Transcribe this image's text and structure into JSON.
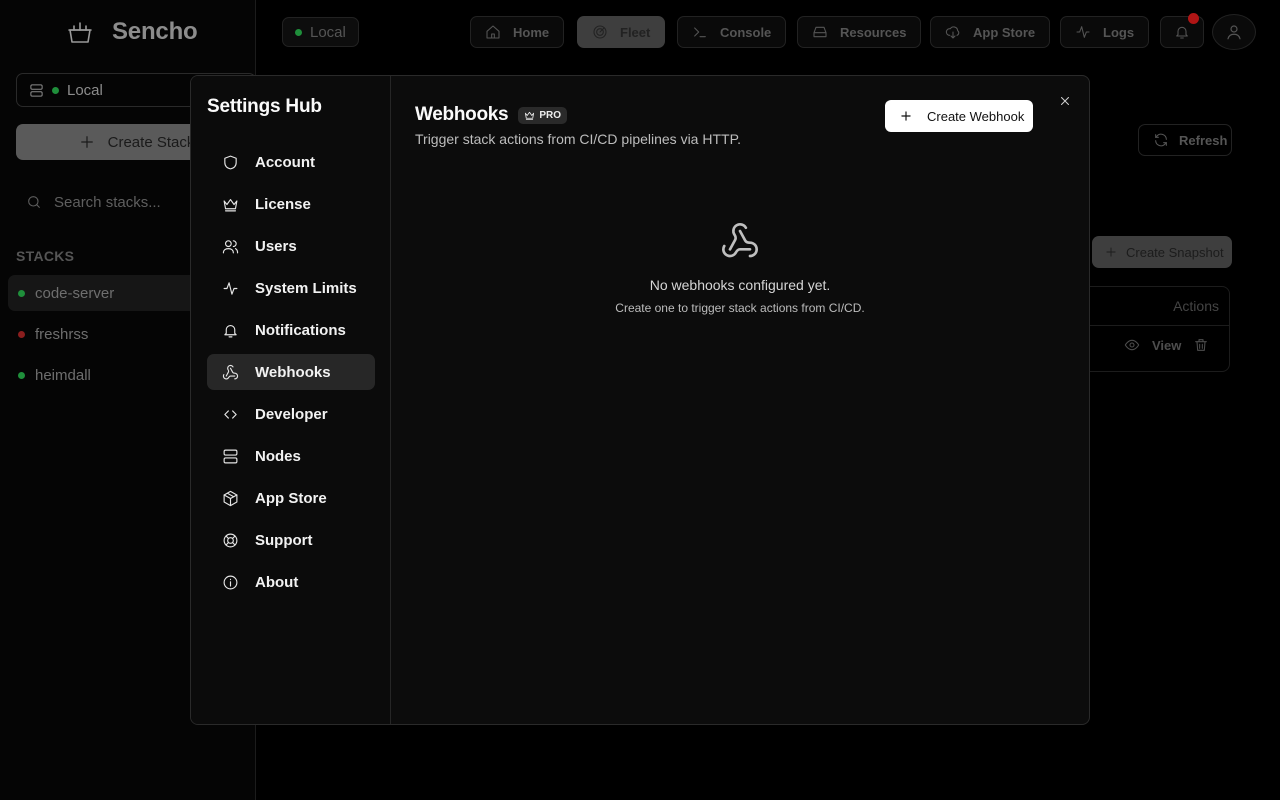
{
  "app": {
    "name": "Sencho",
    "node": "Local",
    "create_stack": "Create Stack",
    "search_placeholder": "Search stacks...",
    "stacks_label": "STACKS",
    "stacks": [
      {
        "name": "code-server",
        "status": "running"
      },
      {
        "name": "freshrss",
        "status": "stopped"
      },
      {
        "name": "heimdall",
        "status": "running"
      }
    ],
    "nav": [
      {
        "label": "Home",
        "icon": "home-icon"
      },
      {
        "label": "Fleet",
        "icon": "radar-icon",
        "active": true
      },
      {
        "label": "Console",
        "icon": "terminal-icon"
      },
      {
        "label": "Resources",
        "icon": "hard-drive-icon"
      },
      {
        "label": "App Store",
        "icon": "cloud-download-icon"
      },
      {
        "label": "Logs",
        "icon": "activity-icon"
      }
    ],
    "refresh": "Refresh",
    "create_snapshot": "Create Snapshot",
    "table_actions_header": "Actions",
    "view": "View"
  },
  "settings": {
    "title": "Settings Hub",
    "menu": [
      {
        "label": "Account",
        "icon": "shield-icon"
      },
      {
        "label": "License",
        "icon": "crown-icon"
      },
      {
        "label": "Users",
        "icon": "users-icon"
      },
      {
        "label": "System Limits",
        "icon": "activity-icon"
      },
      {
        "label": "Notifications",
        "icon": "bell-icon"
      },
      {
        "label": "Webhooks",
        "icon": "webhook-icon",
        "active": true
      },
      {
        "label": "Developer",
        "icon": "code-icon"
      },
      {
        "label": "Nodes",
        "icon": "server-icon"
      },
      {
        "label": "App Store",
        "icon": "package-icon"
      },
      {
        "label": "Support",
        "icon": "life-buoy-icon"
      },
      {
        "label": "About",
        "icon": "info-icon"
      }
    ],
    "page": {
      "title": "Webhooks",
      "badge": "PRO",
      "subtitle": "Trigger stack actions from CI/CD pipelines via HTTP.",
      "create_button": "Create Webhook",
      "empty_title": "No webhooks configured yet.",
      "empty_subtitle": "Create one to trigger stack actions from CI/CD."
    }
  }
}
